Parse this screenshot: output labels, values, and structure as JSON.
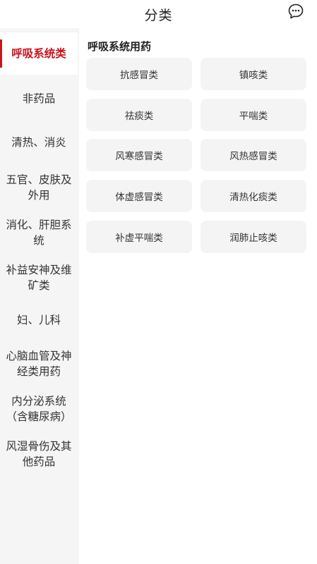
{
  "header": {
    "title": "分类",
    "message_icon": "chat-bubble-icon"
  },
  "sidebar": {
    "items": [
      {
        "label": "呼吸系统类",
        "active": true
      },
      {
        "label": "非药品"
      },
      {
        "label": "清热、消炎"
      },
      {
        "label": "五官、皮肤及外用"
      },
      {
        "label": "消化、肝胆系统"
      },
      {
        "label": "补益安神及维矿类"
      },
      {
        "label": "妇、儿科"
      },
      {
        "label": "心脑血管及神经类用药"
      },
      {
        "label": "内分泌系统（含糖尿病）"
      },
      {
        "label": "风湿骨伤及其他药品"
      }
    ]
  },
  "main": {
    "section_title": "呼吸系统用药",
    "subcategories": [
      "抗感冒类",
      "镇咳类",
      "祛痰类",
      "平喘类",
      "风寒感冒类",
      "风热感冒类",
      "体虚感冒类",
      "清热化痰类",
      "补虚平喘类",
      "润肺止咳类"
    ]
  },
  "colors": {
    "accent": "#c8161e",
    "card_bg": "#f4f4f4",
    "background": "#f5f5f5"
  }
}
